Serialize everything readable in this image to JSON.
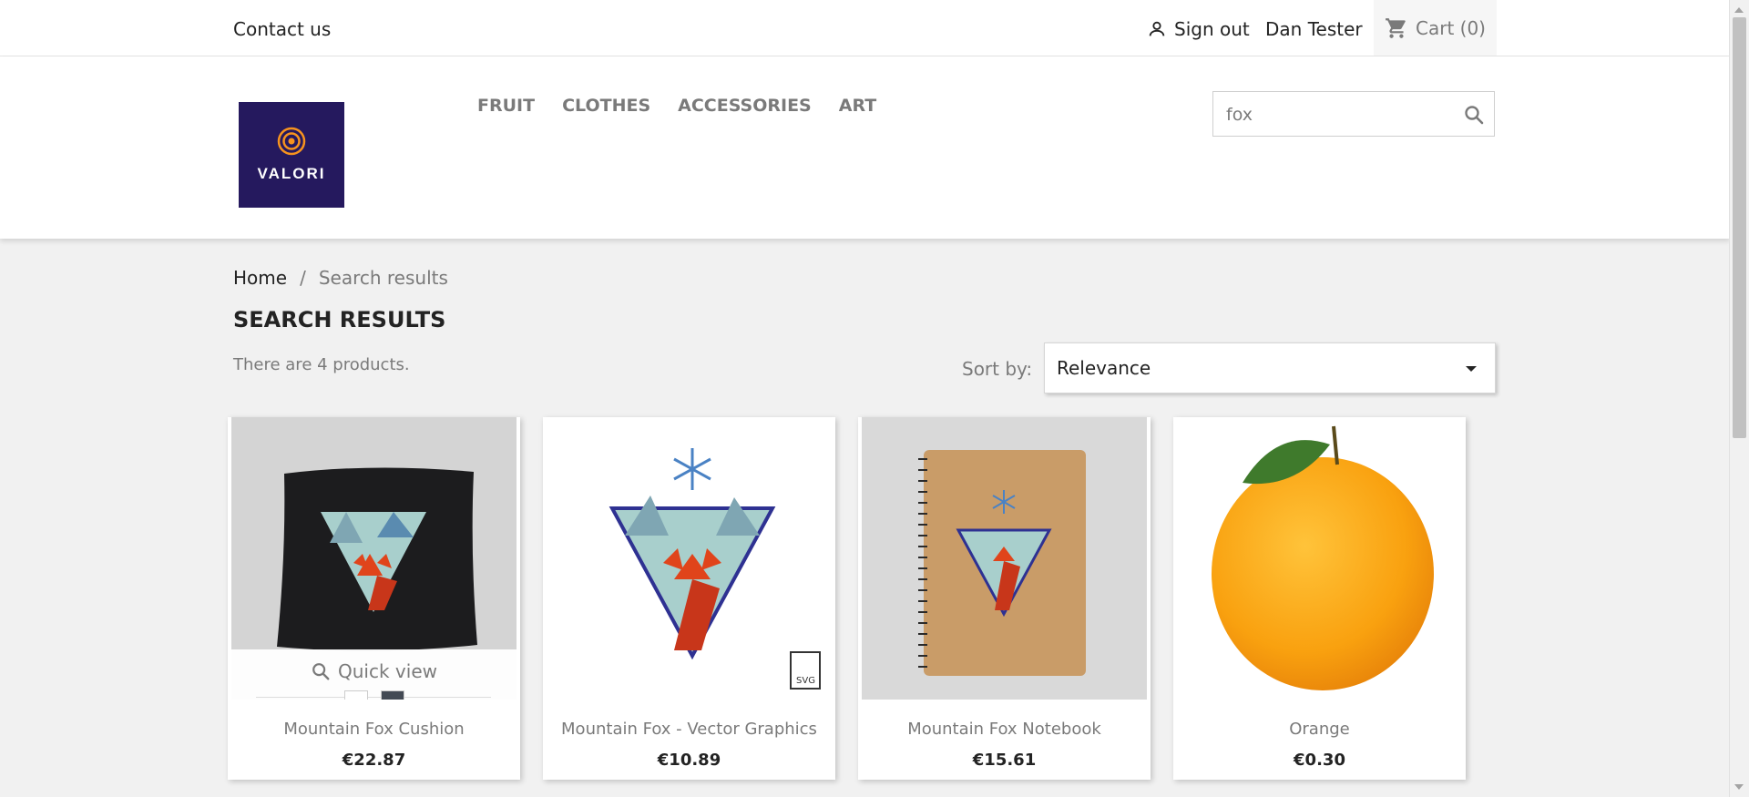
{
  "topbar": {
    "contact": "Contact us",
    "signout": "Sign out",
    "user": "Dan Tester",
    "cart": "Cart (0)"
  },
  "header": {
    "logo_text": "VALORI",
    "nav": [
      "FRUIT",
      "CLOTHES",
      "ACCESSORIES",
      "ART"
    ],
    "search_value": "fox"
  },
  "breadcrumb": {
    "home": "Home",
    "separator": "/",
    "current": "Search results"
  },
  "main": {
    "title": "SEARCH RESULTS",
    "count": "There are 4 products.",
    "sort_label": "Sort by:",
    "sort_value": "Relevance",
    "quick_view": "Quick view"
  },
  "products": [
    {
      "name": "Mountain Fox Cushion",
      "price": "€22.87"
    },
    {
      "name": "Mountain Fox - Vector Graphics",
      "price": "€10.89"
    },
    {
      "name": "Mountain Fox Notebook",
      "price": "€15.61"
    },
    {
      "name": "Orange",
      "price": "€0.30"
    }
  ],
  "colors": {
    "logo_bg": "#25195e",
    "logo_accent": "#f7931e",
    "text": "#232323",
    "muted": "#7a7a7a",
    "page_bg": "#f1f1f1"
  }
}
